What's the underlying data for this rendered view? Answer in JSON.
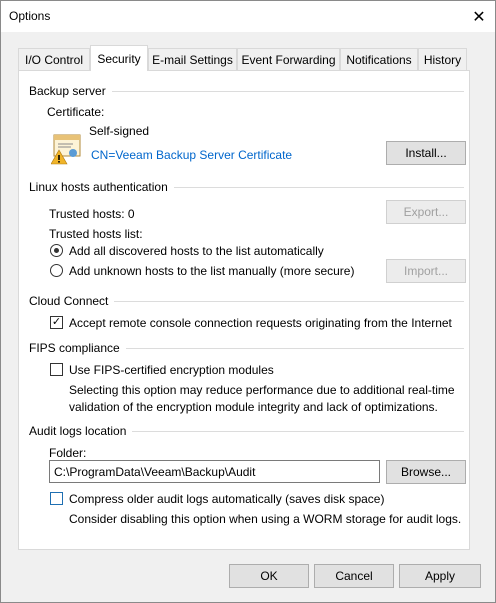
{
  "window": {
    "title": "Options",
    "close_glyph": "✕"
  },
  "tabs": [
    {
      "label": "I/O Control"
    },
    {
      "label": "Security"
    },
    {
      "label": "E-mail Settings"
    },
    {
      "label": "Event Forwarding"
    },
    {
      "label": "Notifications"
    },
    {
      "label": "History"
    }
  ],
  "backup_server": {
    "title": "Backup server",
    "certificate_label": "Certificate:",
    "certificate_type": "Self-signed",
    "certificate_name": "CN=Veeam Backup Server Certificate",
    "install_button": "Install...",
    "certificate_icon": "certificate-warning-icon"
  },
  "linux_auth": {
    "title": "Linux hosts authentication",
    "trusted_hosts": "Trusted hosts: 0",
    "export_button": "Export...",
    "trusted_list_label": "Trusted hosts list:",
    "option_auto": "Add all discovered hosts to the list automatically",
    "option_manual": "Add unknown hosts to the list manually (more secure)",
    "import_button": "Import..."
  },
  "cloud_connect": {
    "title": "Cloud Connect",
    "accept_label": "Accept remote console connection requests originating from the Internet"
  },
  "fips": {
    "title": "FIPS compliance",
    "use_label": "Use FIPS-certified encryption modules",
    "note_line1": "Selecting this option may reduce performance due to additional real-time",
    "note_line2": "validation of the encryption module integrity and lack of optimizations."
  },
  "audit_logs": {
    "title": "Audit logs location",
    "folder_label": "Folder:",
    "folder_value": "C:\\ProgramData\\Veeam\\Backup\\Audit",
    "browse_button": "Browse...",
    "compress_label": "Compress older audit logs automatically (saves disk space)",
    "compress_note": "Consider disabling this option when using a WORM storage for audit logs."
  },
  "footer": {
    "ok": "OK",
    "cancel": "Cancel",
    "apply": "Apply"
  }
}
